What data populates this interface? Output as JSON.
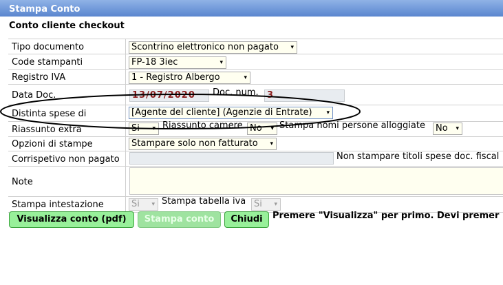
{
  "window": {
    "title": "Stampa Conto"
  },
  "page": {
    "subtitle": "Conto cliente checkout"
  },
  "form": {
    "tipo_documento": {
      "label": "Tipo documento",
      "value": "Scontrino elettronico non pagato"
    },
    "code_stampanti": {
      "label": "Code stampanti",
      "value": "FP-18 3iec"
    },
    "registro_iva": {
      "label": "Registro IVA",
      "value": "1 - Registro Albergo"
    },
    "data_doc": {
      "label": "Data Doc.",
      "value": "13/07/2020",
      "doc_num_label": "Doc. num.",
      "doc_num_value": "3"
    },
    "distinta_spese": {
      "label": "Distinta spese di",
      "value": "[Agente del cliente] (Agenzie di Entrate)"
    },
    "riassunto_extra": {
      "label": "Riassunto extra",
      "value": "Si",
      "camere_label": "Riassunto camere",
      "camere_value": "No",
      "nomi_label": "Stampa nomi persone alloggiate",
      "nomi_value": "No"
    },
    "opzioni_stampe": {
      "label": "Opzioni di stampe",
      "value": "Stampare solo non fatturato"
    },
    "corrispettivo": {
      "label": "Corrispetivo non pagato",
      "side_text": "Non stampare titoli spese doc. fiscal"
    },
    "note": {
      "label": "Note"
    },
    "stampa_intestazione": {
      "label": "Stampa intestazione",
      "value": "Si",
      "tabella_label": "Stampa tabella iva",
      "tabella_value": "Si"
    }
  },
  "buttons": {
    "visualizza": "Visualizza conto (pdf)",
    "stampa": "Stampa conto",
    "chiudi": "Chiudi"
  },
  "hint": "Premere \"Visualizza\" per primo. Devi premer",
  "icons": {
    "dropdown": "▾"
  }
}
